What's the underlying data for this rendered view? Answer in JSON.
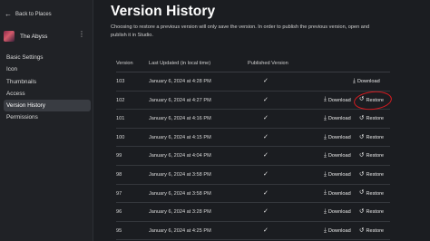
{
  "sidebar": {
    "back_label": "Back to Places",
    "place_name": "The Abyss",
    "items": [
      {
        "label": "Basic Settings"
      },
      {
        "label": "Icon"
      },
      {
        "label": "Thumbnails"
      },
      {
        "label": "Access"
      },
      {
        "label": "Version History",
        "active": true
      },
      {
        "label": "Permissions"
      }
    ]
  },
  "page": {
    "title": "Version History",
    "description": "Choosing to restore a previous version will only save the version. In order to publish the previous version, open and publish it in Studio."
  },
  "table": {
    "headers": {
      "version": "Version",
      "date": "Last Updated (in local time)",
      "published": "Published Version"
    },
    "download_label": "Download",
    "restore_label": "Restore",
    "rows": [
      {
        "version": "103",
        "date": "January 6, 2024 at 4:28 PM",
        "published": true,
        "restorable": false
      },
      {
        "version": "102",
        "date": "January 6, 2024 at 4:27 PM",
        "published": true,
        "restorable": true,
        "highlighted": true
      },
      {
        "version": "101",
        "date": "January 6, 2024 at 4:16 PM",
        "published": true,
        "restorable": true
      },
      {
        "version": "100",
        "date": "January 6, 2024 at 4:15 PM",
        "published": true,
        "restorable": true
      },
      {
        "version": "99",
        "date": "January 6, 2024 at 4:04 PM",
        "published": true,
        "restorable": true
      },
      {
        "version": "98",
        "date": "January 6, 2024 at 3:58 PM",
        "published": true,
        "restorable": true
      },
      {
        "version": "97",
        "date": "January 6, 2024 at 3:58 PM",
        "published": true,
        "restorable": true
      },
      {
        "version": "96",
        "date": "January 6, 2024 at 3:28 PM",
        "published": true,
        "restorable": true
      },
      {
        "version": "95",
        "date": "January 6, 2024 at 4:25 PM",
        "published": true,
        "restorable": true
      }
    ]
  },
  "colors": {
    "background": "#1b1d21",
    "sidebar": "#202226",
    "active_item": "#393c42",
    "annotation": "#d81b20"
  },
  "icons": {
    "back": "arrow-left-icon",
    "more": "vertical-dots-icon",
    "check": "checkmark-icon",
    "download": "download-icon",
    "restore": "restore-icon"
  }
}
